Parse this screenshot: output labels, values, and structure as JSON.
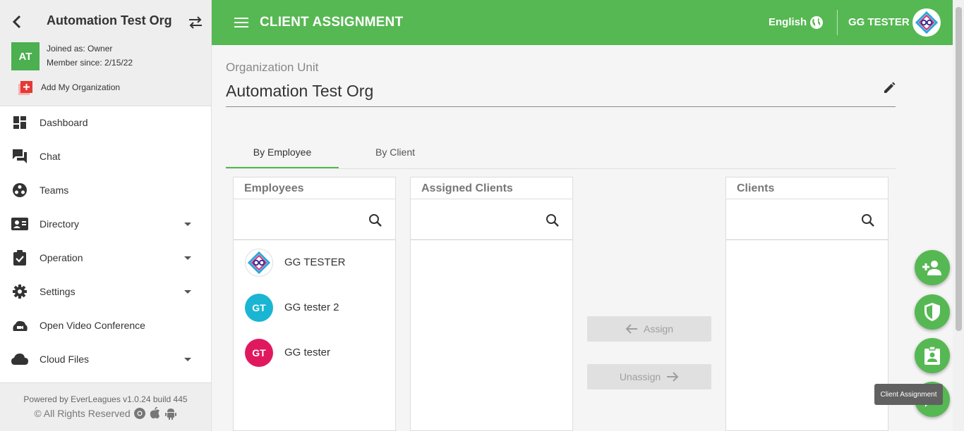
{
  "sidebar": {
    "org_name": "Automation Test Org",
    "avatar_initials": "AT",
    "joined": "Joined as: Owner",
    "member_since": "Member since: 2/15/22",
    "add_org": "Add My Organization",
    "items": [
      {
        "label": "Dashboard",
        "icon": "dashboard-icon"
      },
      {
        "label": "Chat",
        "icon": "chat-icon"
      },
      {
        "label": "Teams",
        "icon": "teams-icon"
      },
      {
        "label": "Directory",
        "icon": "directory-icon"
      },
      {
        "label": "Operation",
        "icon": "operation-icon"
      },
      {
        "label": "Settings",
        "icon": "gear-icon"
      },
      {
        "label": "Open Video Conference",
        "icon": "video-conference-icon"
      },
      {
        "label": "Cloud Files",
        "icon": "cloud-icon"
      }
    ],
    "powered_by": "Powered by EverLeagues v1.0.24 build 445",
    "rights": "© All Rights Reserved"
  },
  "header": {
    "title": "CLIENT ASSIGNMENT",
    "language": "English",
    "user_name": "GG TESTER",
    "color": "#56b852"
  },
  "main": {
    "ou_label": "Organization Unit",
    "ou_value": "Automation Test Org",
    "tabs": [
      {
        "label": "By Employee",
        "active": true
      },
      {
        "label": "By Client",
        "active": false
      }
    ],
    "employees": {
      "title": "Employees",
      "list": [
        {
          "name": "GG TESTER",
          "initials": "",
          "color": "#ffffff"
        },
        {
          "name": "GG tester 2",
          "initials": "GT",
          "color": "#1ab5d3"
        },
        {
          "name": "GG tester",
          "initials": "GT",
          "color": "#e0195e"
        }
      ]
    },
    "assigned_clients": {
      "title": "Assigned Clients"
    },
    "clients": {
      "title": "Clients"
    },
    "assign_label": "Assign",
    "unassign_label": "Unassign"
  },
  "fab_tooltip": "Client Assignment"
}
